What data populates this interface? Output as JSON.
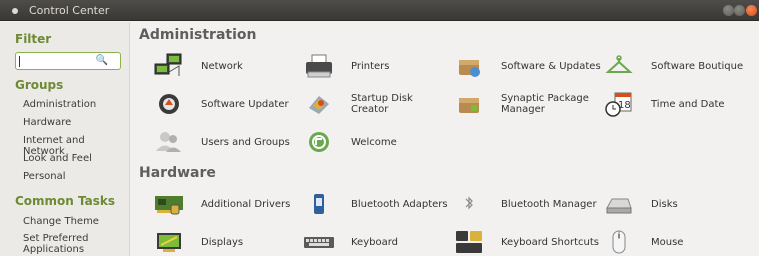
{
  "window": {
    "title": "Control Center"
  },
  "sidebar": {
    "filter_title": "Filter",
    "search": {
      "value": ""
    },
    "groups_title": "Groups",
    "groups": [
      "Administration",
      "Hardware",
      "Internet and Network",
      "Look and Feel",
      "Personal"
    ],
    "tasks_title": "Common Tasks",
    "tasks": [
      "Change Theme",
      "Set Preferred Applications"
    ]
  },
  "main": {
    "admin_heading": "Administration",
    "admin_items": [
      {
        "label": "Network",
        "icon": "network-icon"
      },
      {
        "label": "Printers",
        "icon": "printer-icon"
      },
      {
        "label": "Software & Updates",
        "icon": "software-updates-icon"
      },
      {
        "label": "Software Boutique",
        "icon": "software-boutique-icon"
      },
      {
        "label": "Software Updater",
        "icon": "software-updater-icon"
      },
      {
        "label": "Startup Disk Creator",
        "icon": "startup-disk-icon"
      },
      {
        "label": "Synaptic Package Manager",
        "icon": "synaptic-icon"
      },
      {
        "label": "Time and Date",
        "icon": "clock-calendar-icon"
      },
      {
        "label": "Users and Groups",
        "icon": "users-icon"
      },
      {
        "label": "Welcome",
        "icon": "welcome-icon"
      }
    ],
    "hardware_heading": "Hardware",
    "hardware_items": [
      {
        "label": "Additional Drivers",
        "icon": "drivers-icon"
      },
      {
        "label": "Bluetooth Adapters",
        "icon": "bluetooth-adapter-icon"
      },
      {
        "label": "Bluetooth Manager",
        "icon": "bluetooth-icon"
      },
      {
        "label": "Disks",
        "icon": "disk-icon"
      },
      {
        "label": "Displays",
        "icon": "display-icon"
      },
      {
        "label": "Keyboard",
        "icon": "keyboard-icon"
      },
      {
        "label": "Keyboard Shortcuts",
        "icon": "keyboard-shortcuts-icon"
      },
      {
        "label": "Mouse",
        "icon": "mouse-icon"
      }
    ]
  }
}
